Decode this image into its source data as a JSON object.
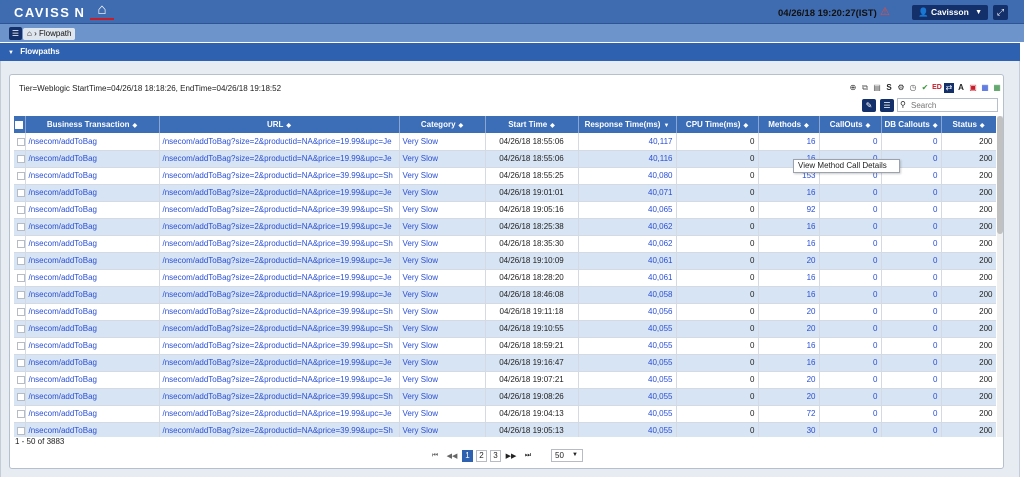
{
  "header": {
    "logo": "CAVISS N",
    "datetime": "04/26/18 19:20:27(IST)",
    "user": "Cavisson"
  },
  "breadcrumb": {
    "current": "Flowpath"
  },
  "section": {
    "title": "Flowpaths"
  },
  "info": {
    "tier_line": "Tier=Weblogic StartTime=04/26/18 18:18:26, EndTime=04/26/18 19:18:52"
  },
  "search": {
    "placeholder": "Search"
  },
  "tooltip": {
    "text": "View Method Call Details"
  },
  "table": {
    "headers": [
      "Business Transaction",
      "URL",
      "Category",
      "Start Time",
      "Response Time(ms)",
      "CPU Time(ms)",
      "Methods",
      "CallOuts",
      "DB Callouts",
      "Status"
    ],
    "rows": [
      [
        "/nsecom/addToBag",
        "/nsecom/addToBag?size=2&productid=NA&price=19.99&upc=Je",
        "Very Slow",
        "04/26/18 18:55:06",
        "40,117",
        "0",
        "16",
        "0",
        "0",
        "200"
      ],
      [
        "/nsecom/addToBag",
        "/nsecom/addToBag?size=2&productid=NA&price=19.99&upc=Je",
        "Very Slow",
        "04/26/18 18:55:06",
        "40,116",
        "0",
        "16",
        "0",
        "0",
        "200"
      ],
      [
        "/nsecom/addToBag",
        "/nsecom/addToBag?size=2&productid=NA&price=39.99&upc=Sh",
        "Very Slow",
        "04/26/18 18:55:25",
        "40,080",
        "0",
        "153",
        "0",
        "0",
        "200"
      ],
      [
        "/nsecom/addToBag",
        "/nsecom/addToBag?size=2&productid=NA&price=19.99&upc=Je",
        "Very Slow",
        "04/26/18 19:01:01",
        "40,071",
        "0",
        "16",
        "0",
        "0",
        "200"
      ],
      [
        "/nsecom/addToBag",
        "/nsecom/addToBag?size=2&productid=NA&price=39.99&upc=Sh",
        "Very Slow",
        "04/26/18 19:05:16",
        "40,065",
        "0",
        "92",
        "0",
        "0",
        "200"
      ],
      [
        "/nsecom/addToBag",
        "/nsecom/addToBag?size=2&productid=NA&price=19.99&upc=Je",
        "Very Slow",
        "04/26/18 18:25:38",
        "40,062",
        "0",
        "16",
        "0",
        "0",
        "200"
      ],
      [
        "/nsecom/addToBag",
        "/nsecom/addToBag?size=2&productid=NA&price=39.99&upc=Sh",
        "Very Slow",
        "04/26/18 18:35:30",
        "40,062",
        "0",
        "16",
        "0",
        "0",
        "200"
      ],
      [
        "/nsecom/addToBag",
        "/nsecom/addToBag?size=2&productid=NA&price=19.99&upc=Je",
        "Very Slow",
        "04/26/18 19:10:09",
        "40,061",
        "0",
        "20",
        "0",
        "0",
        "200"
      ],
      [
        "/nsecom/addToBag",
        "/nsecom/addToBag?size=2&productid=NA&price=19.99&upc=Je",
        "Very Slow",
        "04/26/18 18:28:20",
        "40,061",
        "0",
        "16",
        "0",
        "0",
        "200"
      ],
      [
        "/nsecom/addToBag",
        "/nsecom/addToBag?size=2&productid=NA&price=19.99&upc=Je",
        "Very Slow",
        "04/26/18 18:46:08",
        "40,058",
        "0",
        "16",
        "0",
        "0",
        "200"
      ],
      [
        "/nsecom/addToBag",
        "/nsecom/addToBag?size=2&productid=NA&price=39.99&upc=Sh",
        "Very Slow",
        "04/26/18 19:11:18",
        "40,056",
        "0",
        "20",
        "0",
        "0",
        "200"
      ],
      [
        "/nsecom/addToBag",
        "/nsecom/addToBag?size=2&productid=NA&price=39.99&upc=Sh",
        "Very Slow",
        "04/26/18 19:10:55",
        "40,055",
        "0",
        "20",
        "0",
        "0",
        "200"
      ],
      [
        "/nsecom/addToBag",
        "/nsecom/addToBag?size=2&productid=NA&price=39.99&upc=Sh",
        "Very Slow",
        "04/26/18 18:59:21",
        "40,055",
        "0",
        "16",
        "0",
        "0",
        "200"
      ],
      [
        "/nsecom/addToBag",
        "/nsecom/addToBag?size=2&productid=NA&price=19.99&upc=Je",
        "Very Slow",
        "04/26/18 19:16:47",
        "40,055",
        "0",
        "16",
        "0",
        "0",
        "200"
      ],
      [
        "/nsecom/addToBag",
        "/nsecom/addToBag?size=2&productid=NA&price=19.99&upc=Je",
        "Very Slow",
        "04/26/18 19:07:21",
        "40,055",
        "0",
        "20",
        "0",
        "0",
        "200"
      ],
      [
        "/nsecom/addToBag",
        "/nsecom/addToBag?size=2&productid=NA&price=39.99&upc=Sh",
        "Very Slow",
        "04/26/18 19:08:26",
        "40,055",
        "0",
        "20",
        "0",
        "0",
        "200"
      ],
      [
        "/nsecom/addToBag",
        "/nsecom/addToBag?size=2&productid=NA&price=19.99&upc=Je",
        "Very Slow",
        "04/26/18 19:04:13",
        "40,055",
        "0",
        "72",
        "0",
        "0",
        "200"
      ],
      [
        "/nsecom/addToBag",
        "/nsecom/addToBag?size=2&productid=NA&price=39.99&upc=Sh",
        "Very Slow",
        "04/26/18 19:05:13",
        "40,055",
        "0",
        "30",
        "0",
        "0",
        "200"
      ]
    ]
  },
  "pagination": {
    "range": "1 - 50 of 3883",
    "pages": [
      "1",
      "2",
      "3"
    ],
    "page_size": "50"
  },
  "colors": {
    "accent": "#3f6cb0",
    "header_bar": "#2e62b0",
    "link": "#2a4fd6",
    "alt_row": "#d7e4f3"
  }
}
